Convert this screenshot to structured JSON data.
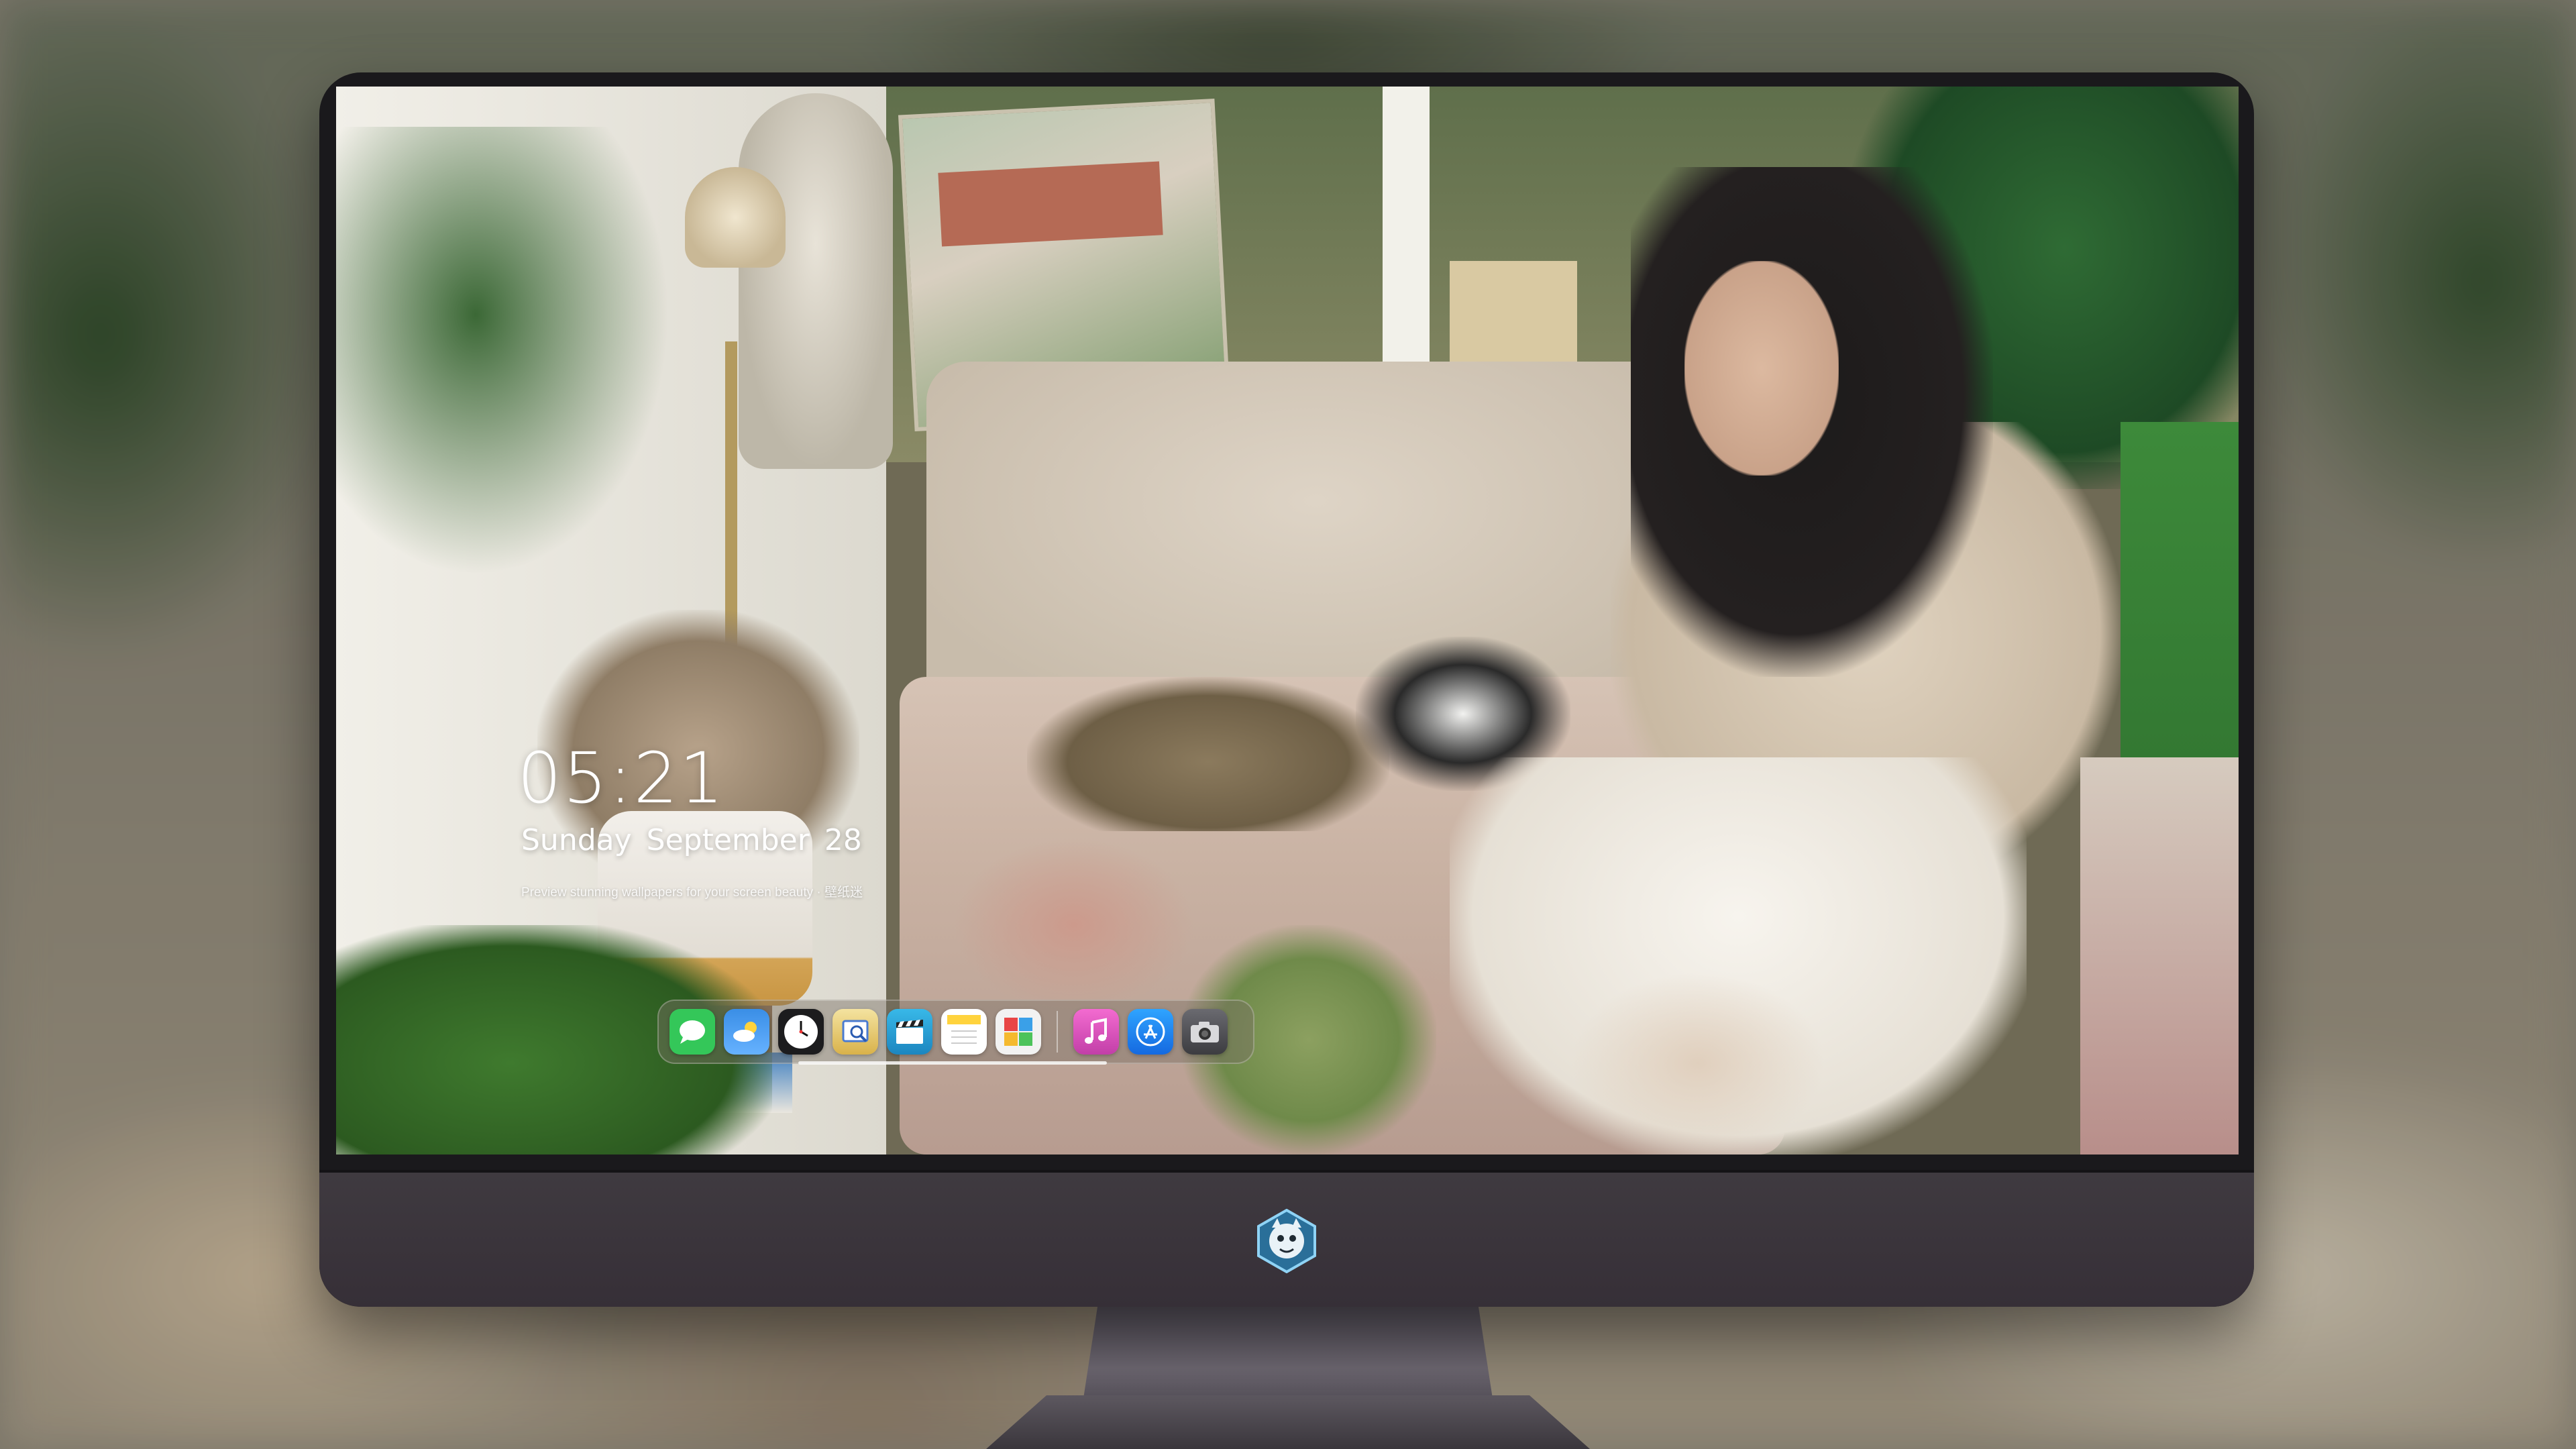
{
  "lockscreen": {
    "time": "05:21",
    "weekday": "Sunday",
    "month": "September",
    "day": "28",
    "caption": "Preview stunning wallpapers for your screen beauty · 壁纸迷"
  },
  "dock": {
    "apps": [
      {
        "name": "Messages",
        "icon": "messages-icon",
        "color": "#34c759",
        "glyph": "💬"
      },
      {
        "name": "Weather",
        "icon": "weather-icon",
        "color": "#3a8ee6",
        "glyph": "⛅"
      },
      {
        "name": "Clock",
        "icon": "clock-icon",
        "color": "#ffffff",
        "glyph": "🕔"
      },
      {
        "name": "Preview",
        "icon": "preview-icon",
        "color": "#e8c45a",
        "glyph": "🔍"
      },
      {
        "name": "Final Cut",
        "icon": "clapper-icon",
        "color": "#2ea6d8",
        "glyph": "🎬"
      },
      {
        "name": "Notes",
        "icon": "notes-icon",
        "color": "#ffd95a",
        "glyph": "📝"
      },
      {
        "name": "Photo Booth",
        "icon": "photobooth-icon",
        "color": "#f0f0f0",
        "glyph": "🖼"
      },
      {
        "name": "Music",
        "icon": "music-icon",
        "color": "#e84fb8",
        "glyph": "♫"
      },
      {
        "name": "App Store",
        "icon": "appstore-icon",
        "color": "#1a8cff",
        "glyph": "A"
      },
      {
        "name": "Camera",
        "icon": "camera-icon",
        "color": "#4a4a4e",
        "glyph": "📷"
      }
    ]
  },
  "colors": {
    "bezel": "#1a191c",
    "chin": "#3a333b"
  }
}
